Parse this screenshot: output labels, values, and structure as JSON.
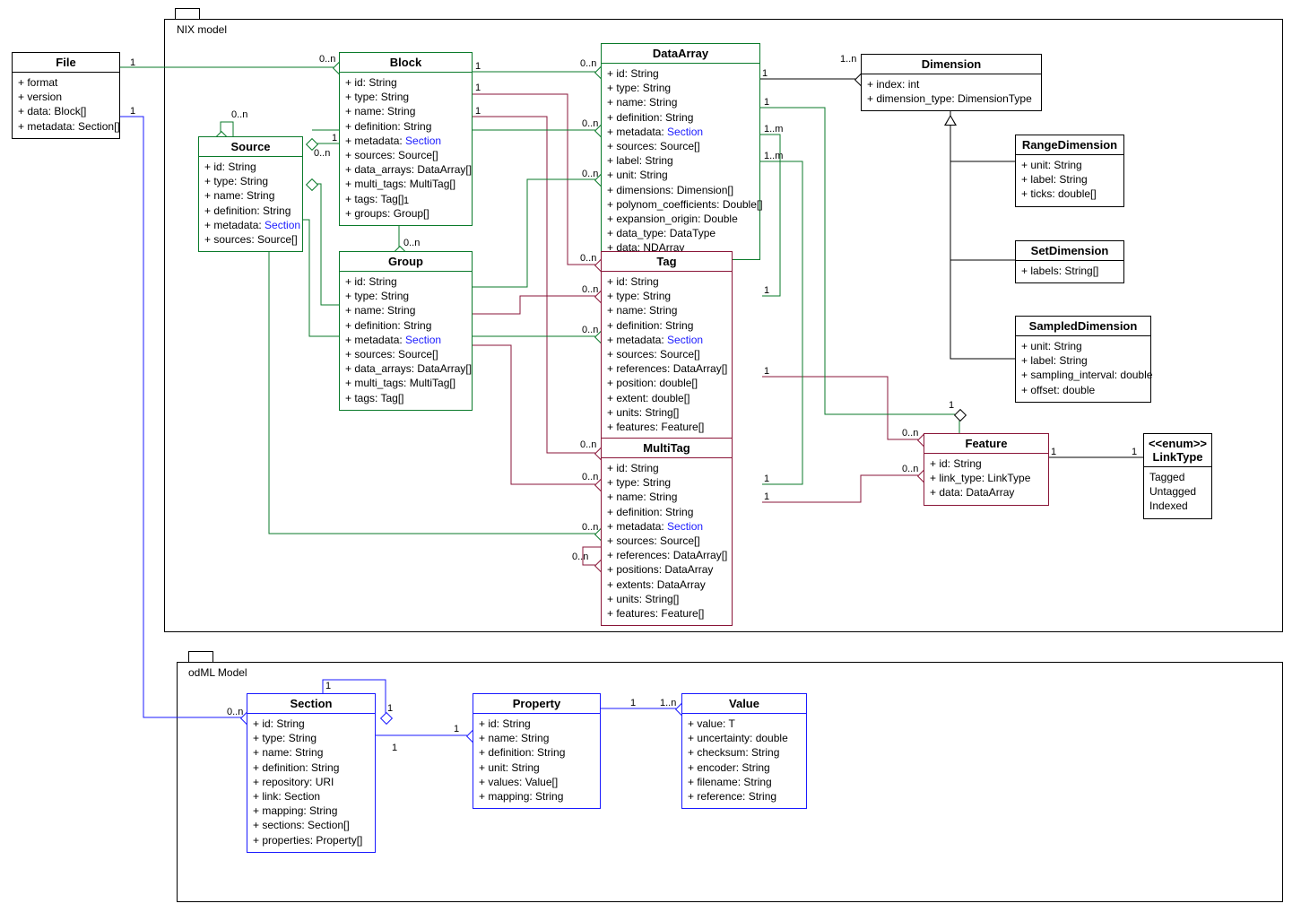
{
  "frames": {
    "nix": {
      "label": "NIX model"
    },
    "odml": {
      "label": "odML Model"
    }
  },
  "classes": {
    "File": {
      "name": "File",
      "attrs": [
        {
          "t": "+ format"
        },
        {
          "t": "+ version"
        },
        {
          "t": "+ data: Block[]"
        },
        {
          "t": "+ metadata: Section[]"
        }
      ]
    },
    "Block": {
      "name": "Block",
      "attrs": [
        {
          "t": "+ id: String"
        },
        {
          "t": "+ type: String"
        },
        {
          "t": "+ name: String"
        },
        {
          "t": "+ definition: String"
        },
        {
          "t": "+ metadata: ",
          "link": "Section"
        },
        {
          "t": "+ sources: Source[]"
        },
        {
          "t": "+ data_arrays: DataArray[]"
        },
        {
          "t": "+ multi_tags: MultiTag[]"
        },
        {
          "t": "+ tags: Tag[]"
        },
        {
          "t": "+ groups: Group[]"
        }
      ]
    },
    "Source": {
      "name": "Source",
      "attrs": [
        {
          "t": "+ id: String"
        },
        {
          "t": "+ type: String"
        },
        {
          "t": "+ name: String"
        },
        {
          "t": "+ definition: String"
        },
        {
          "t": "+ metadata: ",
          "link": "Section"
        },
        {
          "t": "+ sources: Source[]"
        }
      ]
    },
    "Group": {
      "name": "Group",
      "attrs": [
        {
          "t": "+ id: String"
        },
        {
          "t": "+ type: String"
        },
        {
          "t": "+ name: String"
        },
        {
          "t": "+ definition: String"
        },
        {
          "t": "+ metadata: ",
          "link": "Section"
        },
        {
          "t": "+ sources: Source[]"
        },
        {
          "t": "+ data_arrays: DataArray[]"
        },
        {
          "t": "+ multi_tags: MultiTag[]"
        },
        {
          "t": "+ tags: Tag[]"
        }
      ]
    },
    "DataArray": {
      "name": "DataArray",
      "attrs": [
        {
          "t": "+ id: String"
        },
        {
          "t": "+ type: String"
        },
        {
          "t": "+ name: String"
        },
        {
          "t": "+ definition: String"
        },
        {
          "t": "+ metadata: ",
          "link": "Section"
        },
        {
          "t": "+ sources: Source[]"
        },
        {
          "t": "+ label: String"
        },
        {
          "t": "+ unit: String"
        },
        {
          "t": "+ dimensions: Dimension[]"
        },
        {
          "t": "+ polynom_coefficients: Double[]"
        },
        {
          "t": "+ expansion_origin: Double"
        },
        {
          "t": "+ data_type: DataType"
        },
        {
          "t": "+ data: NDArray"
        }
      ]
    },
    "Tag": {
      "name": "Tag",
      "attrs": [
        {
          "t": "+ id: String"
        },
        {
          "t": "+ type: String"
        },
        {
          "t": "+ name: String"
        },
        {
          "t": "+ definition: String"
        },
        {
          "t": "+ metadata: ",
          "link": "Section"
        },
        {
          "t": "+ sources: Source[]"
        },
        {
          "t": "+ references: DataArray[]"
        },
        {
          "t": "+ position: double[]"
        },
        {
          "t": "+ extent: double[]"
        },
        {
          "t": "+ units: String[]"
        },
        {
          "t": "+ features: Feature[]"
        }
      ]
    },
    "MultiTag": {
      "name": "MultiTag",
      "attrs": [
        {
          "t": "+ id: String"
        },
        {
          "t": "+ type: String"
        },
        {
          "t": "+ name: String"
        },
        {
          "t": "+ definition: String"
        },
        {
          "t": "+ metadata: ",
          "link": "Section"
        },
        {
          "t": "+ sources: Source[]"
        },
        {
          "t": "+ references: DataArray[]"
        },
        {
          "t": "+ positions: DataArray"
        },
        {
          "t": "+ extents: DataArray"
        },
        {
          "t": "+ units: String[]"
        },
        {
          "t": "+ features: Feature[]"
        }
      ]
    },
    "Dimension": {
      "name": "Dimension",
      "attrs": [
        {
          "t": "+ index: int"
        },
        {
          "t": "+ dimension_type: DimensionType"
        }
      ]
    },
    "RangeDimension": {
      "name": "RangeDimension",
      "attrs": [
        {
          "t": "+ unit: String"
        },
        {
          "t": "+ label: String"
        },
        {
          "t": "+ ticks: double[]"
        }
      ]
    },
    "SetDimension": {
      "name": "SetDimension",
      "attrs": [
        {
          "t": "+ labels: String[]"
        }
      ]
    },
    "SampledDimension": {
      "name": "SampledDimension",
      "attrs": [
        {
          "t": "+ unit: String"
        },
        {
          "t": "+ label: String"
        },
        {
          "t": "+ sampling_interval: double"
        },
        {
          "t": "+ offset: double"
        }
      ]
    },
    "Feature": {
      "name": "Feature",
      "attrs": [
        {
          "t": "+ id: String"
        },
        {
          "t": "+ link_type: LinkType"
        },
        {
          "t": "+ data: DataArray"
        }
      ]
    },
    "LinkType": {
      "name": "<<enum>>\nLinkType",
      "attrs": [
        {
          "t": "Tagged"
        },
        {
          "t": "Untagged"
        },
        {
          "t": "Indexed"
        }
      ]
    },
    "Section": {
      "name": "Section",
      "attrs": [
        {
          "t": "+ id: String"
        },
        {
          "t": "+ type: String"
        },
        {
          "t": "+ name: String"
        },
        {
          "t": "+ definition: String"
        },
        {
          "t": "+ repository: URI"
        },
        {
          "t": "+ link: Section"
        },
        {
          "t": "+ mapping: String"
        },
        {
          "t": "+ sections: Section[]"
        },
        {
          "t": "+ properties: Property[]"
        }
      ]
    },
    "Property": {
      "name": "Property",
      "attrs": [
        {
          "t": "+ id: String"
        },
        {
          "t": "+ name: String"
        },
        {
          "t": "+ definition: String"
        },
        {
          "t": "+ unit: String"
        },
        {
          "t": "+ values: Value[]"
        },
        {
          "t": "+ mapping: String"
        }
      ]
    },
    "Value": {
      "name": "Value",
      "attrs": [
        {
          "t": "+ value: T"
        },
        {
          "t": "+ uncertainty: double"
        },
        {
          "t": "+ checksum: String"
        },
        {
          "t": "+ encoder: String"
        },
        {
          "t": "+ filename: String"
        },
        {
          "t": "+ reference: String"
        }
      ]
    }
  },
  "mults": {
    "m1": "1",
    "m2": "0..n",
    "m3": "1",
    "m4": "1",
    "m5": "0..n",
    "m6": "1",
    "m7": "0..n",
    "m8": "1",
    "m9": "0..n",
    "m10": "1",
    "m11": "1",
    "m12": "1..n",
    "m13": "0..n",
    "m14": "1",
    "m15": "0..n",
    "m16": "1",
    "m17": "1",
    "m18": "1..m",
    "m19": "0..n",
    "m20": "1",
    "m21": "0..n",
    "m22": "1",
    "m23": "1",
    "m24": "1..m",
    "m25": "0..n",
    "m26": "0..n",
    "m27": "1",
    "m28": "1",
    "m29": "0..n",
    "m30": "1",
    "m31": "0..n",
    "m32": "0..n",
    "m33": "1",
    "m34": "1..n",
    "m35": "0..n",
    "m36": "1",
    "m37": "0..n",
    "m38": "0..n",
    "m39": "0..n",
    "m40": "1",
    "m41": "1",
    "m42": "1",
    "m43": "1",
    "m44": "1"
  }
}
